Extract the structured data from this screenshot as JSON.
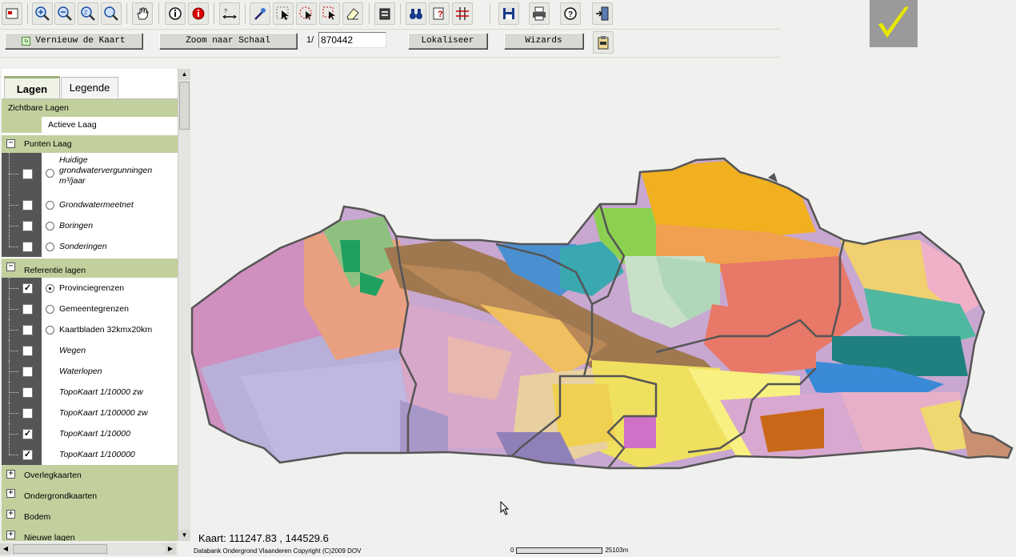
{
  "toolbar": {
    "buttons": [
      {
        "icon": "map-window-icon"
      },
      {
        "icon": "zoom-in-icon"
      },
      {
        "icon": "zoom-out-icon"
      },
      {
        "icon": "zoom-full-icon"
      },
      {
        "icon": "zoom-selection-icon"
      },
      {
        "icon": "pan-hand-icon"
      },
      {
        "icon": "info-icon"
      },
      {
        "icon": "info-red-icon"
      },
      {
        "icon": "measure-icon"
      },
      {
        "icon": "select-wand-icon"
      },
      {
        "icon": "select-arrow-icon"
      },
      {
        "icon": "select-circle-icon"
      },
      {
        "icon": "select-rect-icon"
      },
      {
        "icon": "eraser-icon"
      },
      {
        "icon": "layers-stack-icon"
      },
      {
        "icon": "binoculars-icon"
      },
      {
        "icon": "query-icon"
      },
      {
        "icon": "grid-icon"
      },
      {
        "icon": "save-icon"
      },
      {
        "icon": "print-icon"
      },
      {
        "icon": "help-icon"
      },
      {
        "icon": "exit-icon"
      }
    ]
  },
  "controls": {
    "refresh_label": "Vernieuw de Kaart",
    "zoom_scale_label": "Zoom naar Schaal",
    "scale_prefix": "1/",
    "scale_value": "870442",
    "locate_label": "Lokaliseer",
    "wizards_label": "Wizards"
  },
  "panel": {
    "tabs": [
      {
        "label": "Lagen"
      },
      {
        "label": "Legende"
      }
    ],
    "visible_layers_title": "Zichtbare Lagen",
    "active_layer_label": "Actieve Laag",
    "groups": {
      "points": {
        "label": "Punten Laag",
        "layers": [
          {
            "name": "Huidige grondwatervergunningen m³/jaar"
          },
          {
            "name": "Grondwatermeetnet"
          },
          {
            "name": "Boringen"
          },
          {
            "name": "Sonderingen"
          }
        ]
      },
      "reference": {
        "label": "Referentie lagen",
        "layers": [
          {
            "name": "Provinciegrenzen",
            "checked": "✓"
          },
          {
            "name": "Gemeentegrenzen",
            "checked": ""
          },
          {
            "name": "Kaartbladen 32kmx20km",
            "checked": ""
          },
          {
            "name": "Wegen",
            "checked": ""
          },
          {
            "name": "Waterlopen",
            "checked": ""
          },
          {
            "name": "TopoKaart 1/10000 zw",
            "checked": ""
          },
          {
            "name": "TopoKaart 1/100000 zw",
            "checked": ""
          },
          {
            "name": "TopoKaart 1/10000",
            "checked": "✓"
          },
          {
            "name": "TopoKaart 1/100000",
            "checked": "✓"
          }
        ]
      },
      "collapsed": [
        {
          "label": "Overlegkaarten"
        },
        {
          "label": "Ondergrondkaarten"
        },
        {
          "label": "Bodem"
        },
        {
          "label": "Nieuwe lagen"
        }
      ]
    }
  },
  "map": {
    "coordinates": "Kaart: 111247.83 , 144529.6",
    "copyright": "Databank Ondergrond Vlaanderen Copyright (C)2009 DOV",
    "scalebar_start": "0",
    "scalebar_end": "25103m"
  },
  "colors": {
    "panel_green": "#c2d09e",
    "gutter_dark": "#555555",
    "logo_check": "#e8e800"
  }
}
